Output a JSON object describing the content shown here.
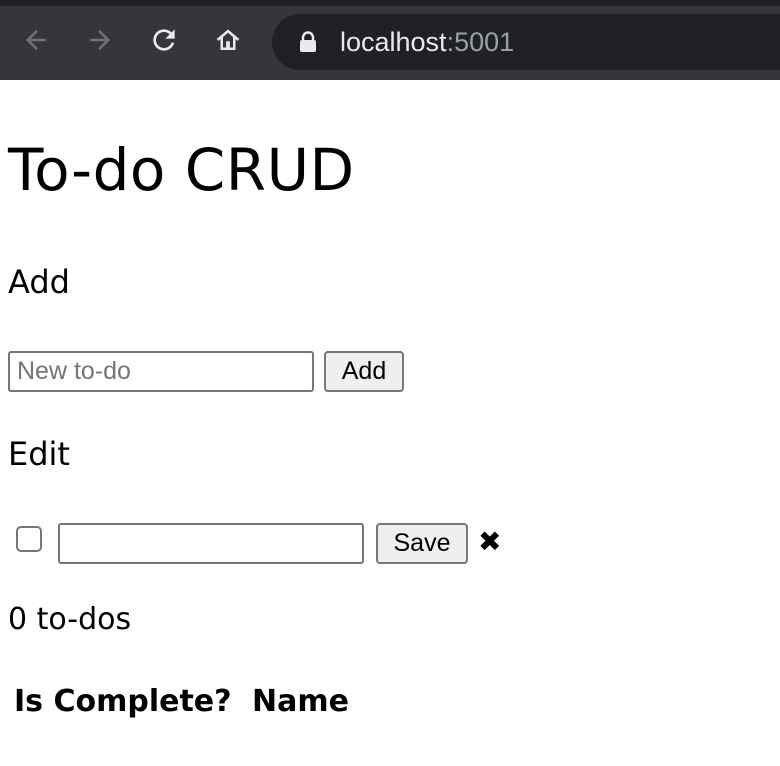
{
  "browser": {
    "url_host": "localhost",
    "url_port": ":5001",
    "icons": [
      "back-icon",
      "forward-icon",
      "reload-icon",
      "home-icon",
      "lock-icon"
    ]
  },
  "page": {
    "title": "To-do CRUD",
    "add_section": {
      "heading": "Add",
      "input_placeholder": "New to-do",
      "input_value": "",
      "button_label": "Add"
    },
    "edit_section": {
      "heading": "Edit",
      "checkbox_checked": false,
      "input_value": "",
      "save_label": "Save",
      "delete_glyph": "✖"
    },
    "count_text": "0 to-dos",
    "table": {
      "headers": [
        "Is Complete?",
        "Name"
      ]
    }
  }
}
